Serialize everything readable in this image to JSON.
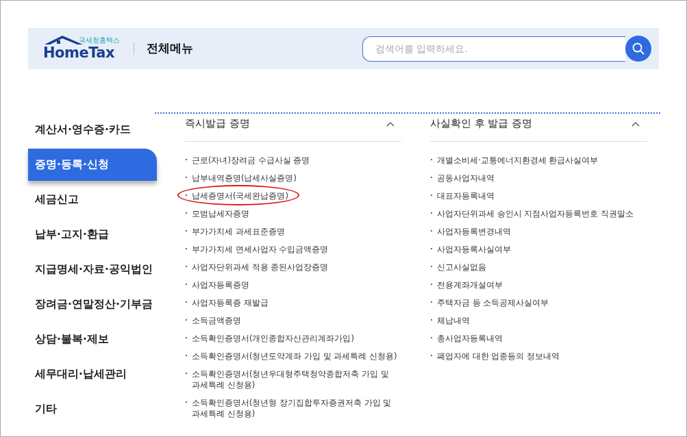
{
  "header": {
    "logo_subtitle": "국세청홈택스",
    "logo_title": "HomeTax",
    "title": "전체메뉴",
    "search": {
      "placeholder": "검색어를 입력하세요."
    }
  },
  "sidebar": {
    "items": [
      {
        "label": "계산서·영수증·카드",
        "selected": false
      },
      {
        "label": "증명·등록·신청",
        "selected": true
      },
      {
        "label": "세금신고",
        "selected": false
      },
      {
        "label": "납부·고지·환급",
        "selected": false
      },
      {
        "label": "지급명세·자료·공익법인",
        "selected": false
      },
      {
        "label": "장려금·연말정산·기부금",
        "selected": false
      },
      {
        "label": "상담·불복·제보",
        "selected": false
      },
      {
        "label": "세무대리·납세관리",
        "selected": false
      },
      {
        "label": "기타",
        "selected": false
      }
    ]
  },
  "sections": [
    {
      "title": "즉시발급 증명",
      "expanded": true,
      "items": [
        {
          "label": "근로(자녀)장려금 수급사실 증명",
          "circled": false
        },
        {
          "label": "납부내역증명(납세사실증명)",
          "circled": false
        },
        {
          "label": "납세증명서(국세완납증명)",
          "circled": true
        },
        {
          "label": "모범납세자증명",
          "circled": false
        },
        {
          "label": "부가가치세 과세표준증명",
          "circled": false
        },
        {
          "label": "부가가치세 면세사업자 수입금액증명",
          "circled": false
        },
        {
          "label": "사업자단위과세 적용 종된사업장증명",
          "circled": false
        },
        {
          "label": "사업자등록증명",
          "circled": false
        },
        {
          "label": "사업자등록증 재발급",
          "circled": false
        },
        {
          "label": "소득금액증명",
          "circled": false
        },
        {
          "label": "소득확인증명서(개인종합자산관리계좌가입)",
          "circled": false
        },
        {
          "label": "소득확인증명서(청년도약계좌 가입 및 과세특례 신청용)",
          "circled": false
        },
        {
          "label": "소득확인증명서(청년우대형주택청약종합저축 가입 및 과세특례 신청용)",
          "circled": false
        },
        {
          "label": "소득확인증명서(청년형 장기집합투자증권저축 가입 및 과세특례 신청용)",
          "circled": false
        }
      ]
    },
    {
      "title": "사실확인 후 발급 증명",
      "expanded": true,
      "items": [
        {
          "label": "개별소비세·교통에너지환경세 환급사실여부",
          "circled": false
        },
        {
          "label": "공동사업자내역",
          "circled": false
        },
        {
          "label": "대표자등록내역",
          "circled": false
        },
        {
          "label": "사업자단위과세 승인시 지점사업자등록번호 직권말소",
          "circled": false
        },
        {
          "label": "사업자등록변경내역",
          "circled": false
        },
        {
          "label": "사업자등록사실여부",
          "circled": false
        },
        {
          "label": "신고사실없음",
          "circled": false
        },
        {
          "label": "전용계좌개설여부",
          "circled": false
        },
        {
          "label": "주택자금 등 소득공제사실여부",
          "circled": false
        },
        {
          "label": "체납내역",
          "circled": false
        },
        {
          "label": "총사업자등록내역",
          "circled": false
        },
        {
          "label": "폐업자에 대한 업종등의 정보내역",
          "circled": false
        }
      ]
    }
  ]
}
